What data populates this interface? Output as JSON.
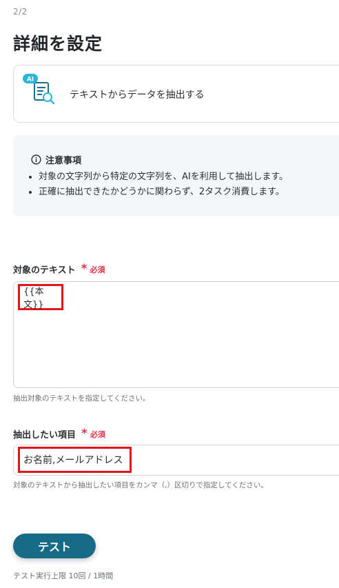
{
  "step": "2/2",
  "page_title": "詳細を設定",
  "action": {
    "icon_badge": "AI",
    "label": "テキストからデータを抽出する",
    "icon": "ai-document-search-icon"
  },
  "notice": {
    "title": "注意事項",
    "items": [
      "対象の文字列から特定の文字列を、AIを利用して抽出します。",
      "正確に抽出できたかどうかに関わらず、2タスク消費します。"
    ]
  },
  "fields": {
    "target_text": {
      "label": "対象のテキスト",
      "required_mark": "*",
      "required_text": "必須",
      "value": "{{本文}}",
      "hint": "抽出対象のテキストを指定してください。"
    },
    "extract_items": {
      "label": "抽出したい項目",
      "required_mark": "*",
      "required_text": "必須",
      "value": "お名前,メールアドレス",
      "hint": "対象のテキストから抽出したい項目をカンマ（,）区切りで指定してください。"
    }
  },
  "test_button": {
    "label": "テスト"
  },
  "limit_text": "テスト実行上限 10回 / 1時間",
  "colors": {
    "accent": "#176b86",
    "required": "#e0364c",
    "highlight": "#e3141b",
    "ai_badge": "#26b6d8"
  }
}
